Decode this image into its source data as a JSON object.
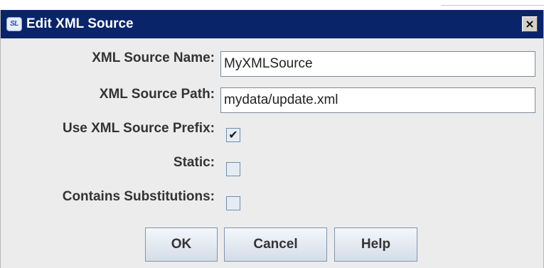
{
  "dialog": {
    "title": "Edit XML Source",
    "app_icon_text": "SL",
    "close_glyph": "×"
  },
  "fields": {
    "name_label": "XML Source Name:",
    "name_value": "MyXMLSource",
    "path_label": "XML Source Path:",
    "path_value": "mydata/update.xml"
  },
  "options": {
    "prefix_label": "Use XML Source Prefix:",
    "prefix_checked": true,
    "prefix_glyph": "✔",
    "static_label": "Static:",
    "static_checked": false,
    "subs_label": "Contains Substitutions:",
    "subs_checked": false
  },
  "buttons": {
    "ok": "OK",
    "cancel": "Cancel",
    "help": "Help"
  }
}
